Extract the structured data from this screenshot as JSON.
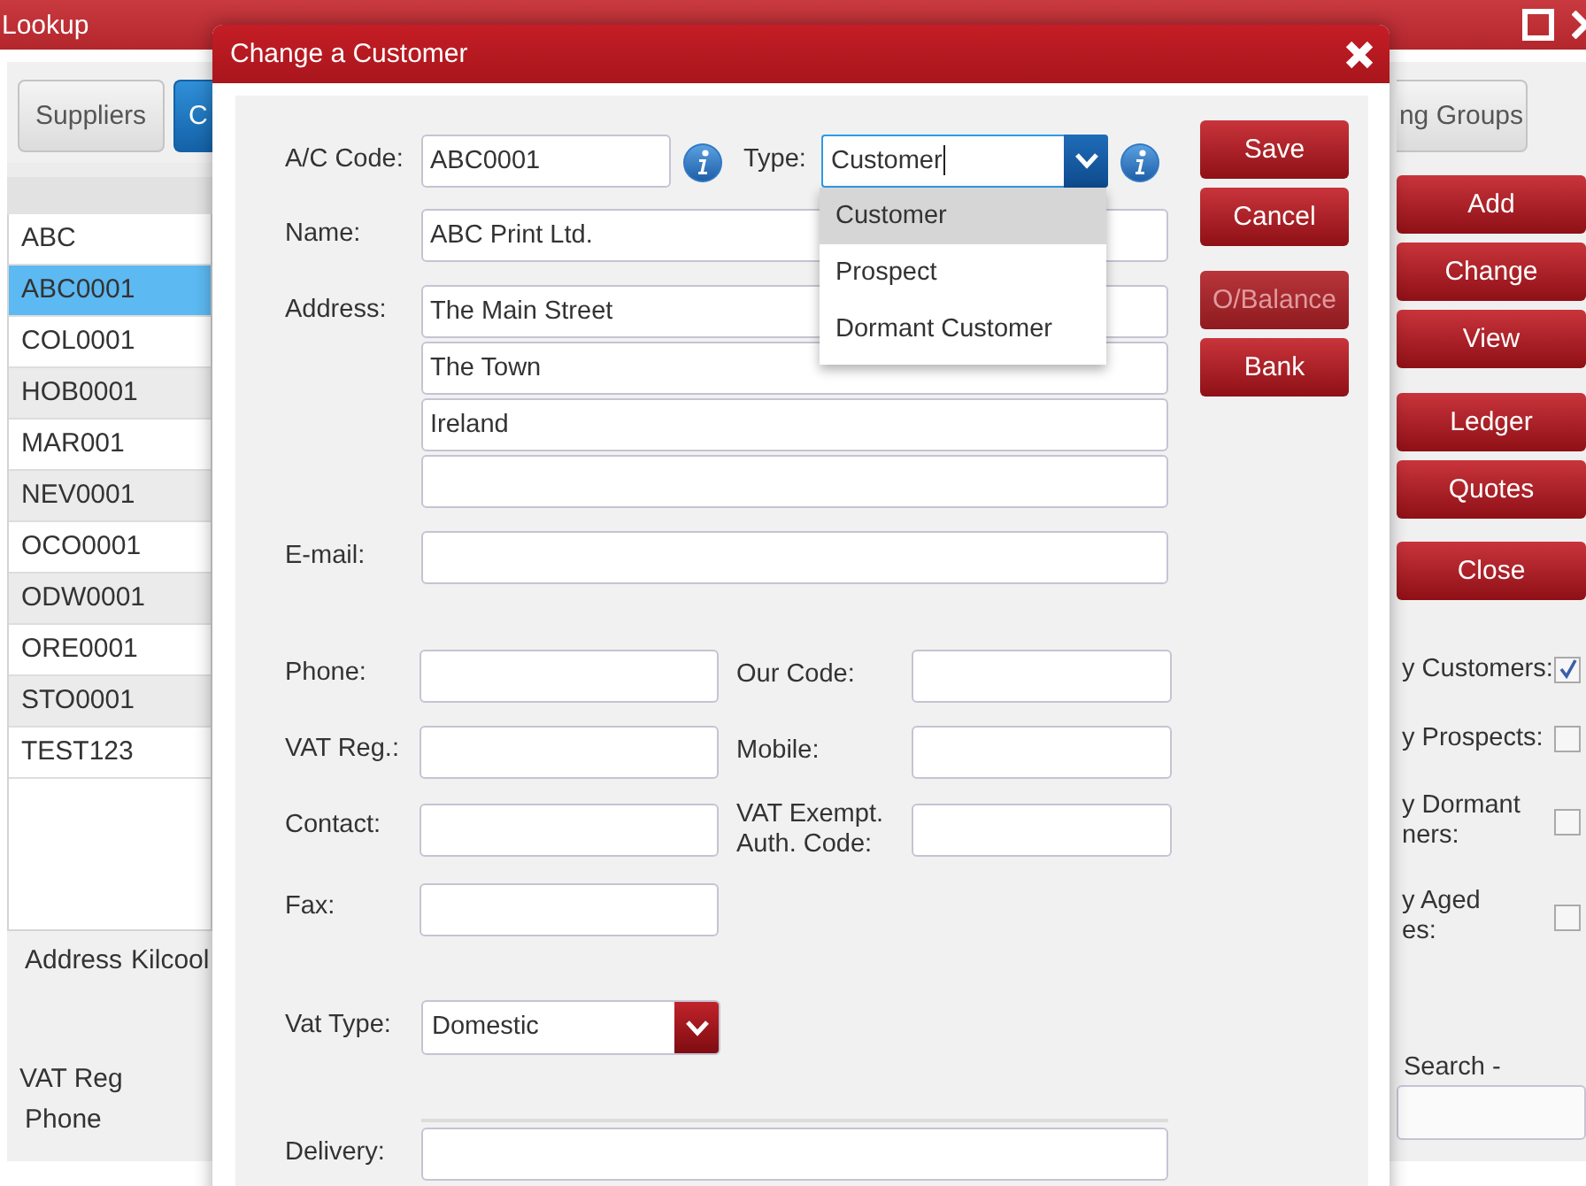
{
  "window": {
    "title": "Lookup"
  },
  "tabs": [
    {
      "label": "Suppliers",
      "selected": false
    },
    {
      "label": "C",
      "selected": true
    },
    {
      "label": "ng Groups",
      "selected": false
    }
  ],
  "list": {
    "rows": [
      {
        "code": "ABC",
        "selected": false
      },
      {
        "code": "ABC0001",
        "selected": true
      },
      {
        "code": "COL0001",
        "selected": false
      },
      {
        "code": "HOB0001",
        "selected": false
      },
      {
        "code": "MAR001",
        "selected": false
      },
      {
        "code": "NEV0001",
        "selected": false
      },
      {
        "code": "OCO0001",
        "selected": false
      },
      {
        "code": "ODW0001",
        "selected": false
      },
      {
        "code": "ORE0001",
        "selected": false
      },
      {
        "code": "STO0001",
        "selected": false
      },
      {
        "code": "TEST123",
        "selected": false
      }
    ]
  },
  "details": [
    {
      "label": "Address",
      "value": "Kilcool"
    },
    {
      "label": "VAT Reg"
    },
    {
      "label": "Phone"
    }
  ],
  "actions": [
    "Add",
    "Change",
    "View",
    "Ledger",
    "Quotes",
    "Close"
  ],
  "filters": [
    {
      "lines": [
        "y Customers:"
      ],
      "checked": true
    },
    {
      "lines": [
        "y Prospects:"
      ],
      "checked": false
    },
    {
      "lines": [
        "y Dormant",
        "ners:"
      ],
      "checked": false
    },
    {
      "lines": [
        "y Aged",
        "es:"
      ],
      "checked": false
    }
  ],
  "search": {
    "label": "Search -"
  },
  "dialog": {
    "title": "Change a Customer",
    "ac_code": {
      "label": "A/C Code:",
      "value": "ABC0001"
    },
    "type": {
      "label": "Type:",
      "value": "Customer",
      "options": [
        {
          "label": "Customer",
          "selected": true
        },
        {
          "label": "Prospect",
          "selected": false
        },
        {
          "label": "Dormant Customer",
          "selected": false
        }
      ]
    },
    "name": {
      "label": "Name:",
      "value": "ABC Print Ltd."
    },
    "address": {
      "label": "Address:",
      "lines": [
        "The Main Street",
        "The Town",
        "Ireland"
      ]
    },
    "email": {
      "label": "E-mail:"
    },
    "grid": [
      [
        {
          "label": "Phone:"
        },
        {
          "label": "Our Code:"
        }
      ],
      [
        {
          "label": "VAT Reg.:"
        },
        {
          "label": "Mobile:"
        }
      ],
      [
        {
          "label": "Contact:"
        },
        {
          "label": "VAT Exempt. Auth. Code:"
        }
      ],
      [
        {
          "label": "Fax:"
        }
      ]
    ],
    "vat_type": {
      "label": "Vat Type:",
      "value": "Domestic"
    },
    "delivery": {
      "label": "Delivery:"
    },
    "buttons": [
      {
        "label": "Save",
        "disabled": false
      },
      {
        "label": "Cancel",
        "disabled": false
      },
      {
        "label": "O/Balance",
        "disabled": true
      },
      {
        "label": "Bank",
        "disabled": false
      }
    ]
  }
}
